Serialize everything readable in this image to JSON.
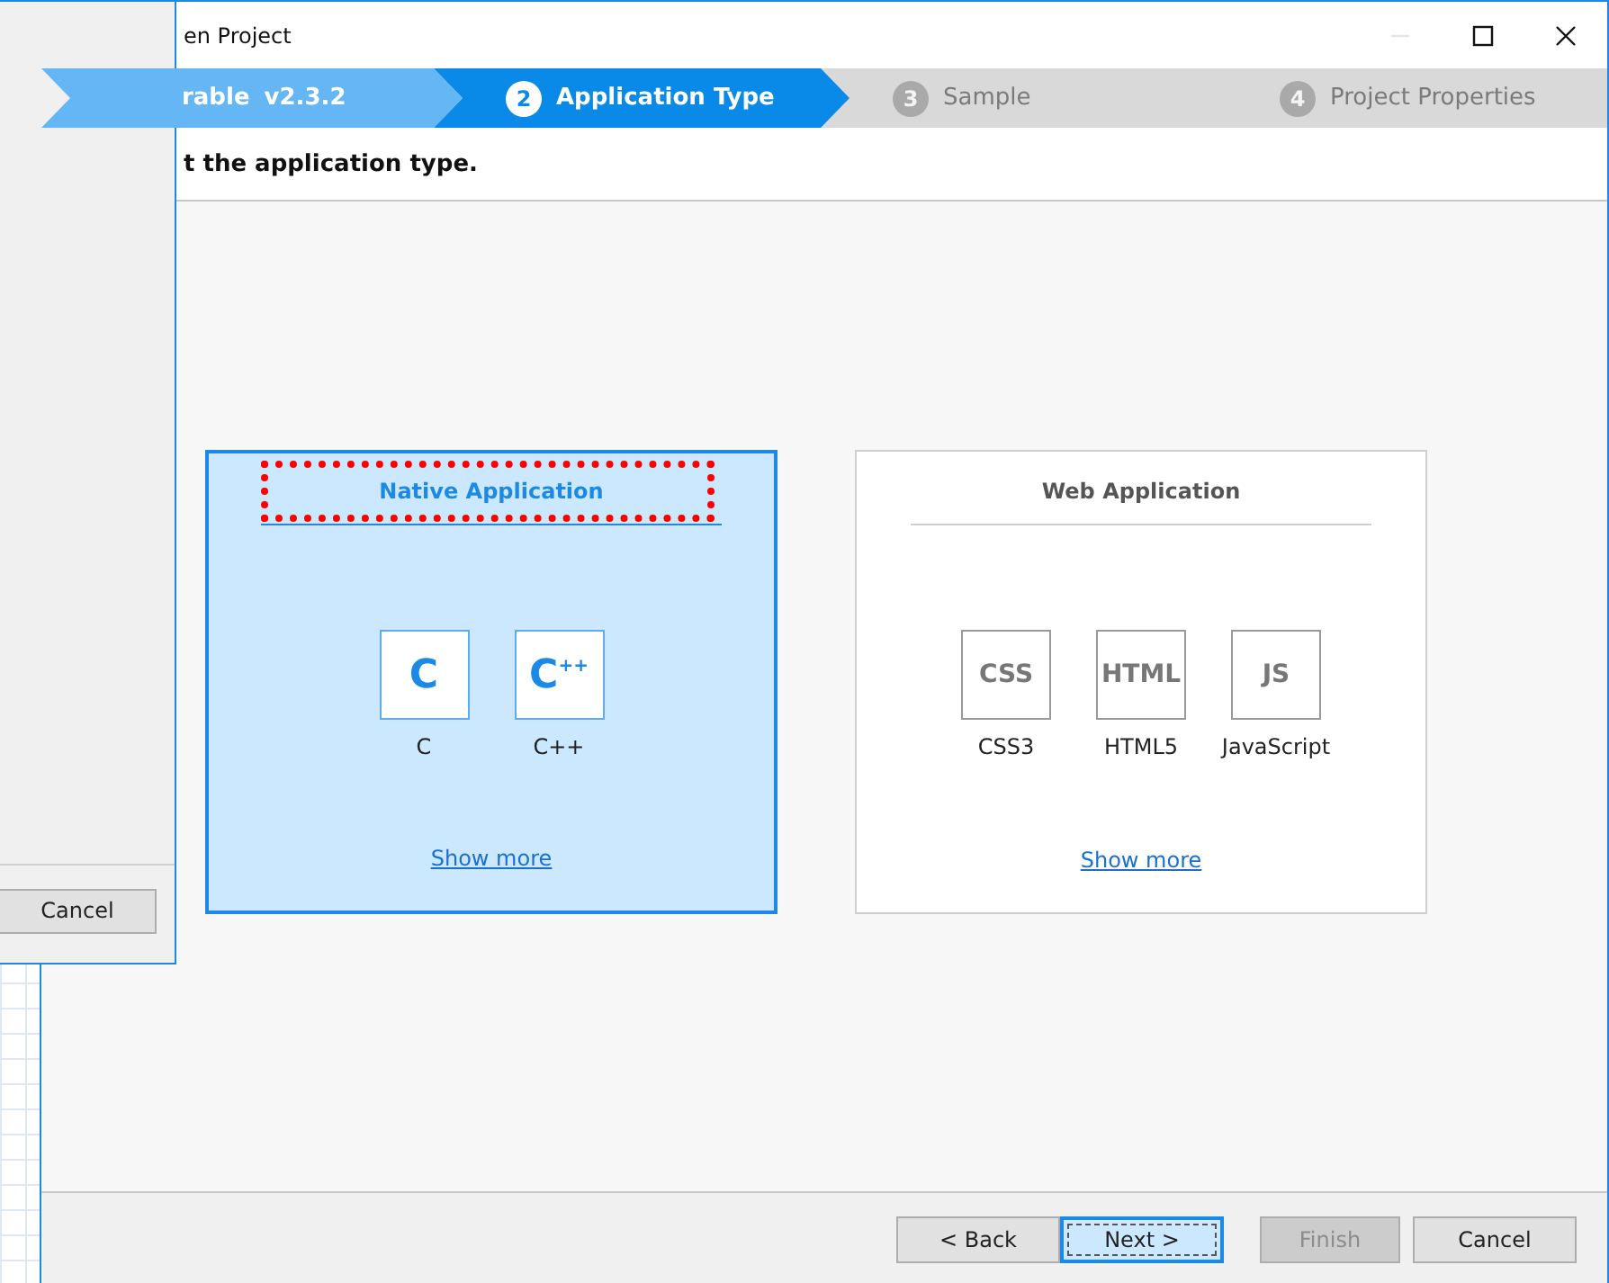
{
  "back_dialog": {
    "buttons": [
      {
        "label": "Cancel"
      }
    ]
  },
  "window": {
    "title": "en Project",
    "controls": [
      {
        "kind": "minimize",
        "disabled": true
      },
      {
        "kind": "maximize",
        "disabled": false
      },
      {
        "kind": "close",
        "disabled": false
      }
    ]
  },
  "steps": [
    {
      "label": "rable",
      "version": "v2.3.2",
      "selected": false,
      "done": true
    },
    {
      "number": "2",
      "label": "Application Type",
      "selected": true,
      "done": false
    },
    {
      "number": "3",
      "label": "Sample",
      "selected": false,
      "done": false
    },
    {
      "number": "4",
      "label": "Project Properties",
      "selected": false,
      "done": false
    }
  ],
  "instruction": "t the application type.",
  "cards": [
    {
      "title": "Native Application",
      "selected": true,
      "focused": true,
      "templates": [
        {
          "icon": "C",
          "label": "C"
        },
        {
          "icon": "C",
          "sup": "++",
          "label": "C++"
        }
      ],
      "link": "Show more"
    },
    {
      "title": "Web Application",
      "selected": false,
      "focused": false,
      "templates": [
        {
          "icon": "CSS",
          "label": "CSS3"
        },
        {
          "icon": "HTML",
          "label": "HTML5"
        },
        {
          "icon": "JS",
          "label": "JavaScript"
        }
      ],
      "link": "Show more"
    }
  ],
  "buttons": [
    {
      "label": "< Back",
      "disabled": false,
      "default": false
    },
    {
      "label": "Next >",
      "disabled": false,
      "default": true
    },
    {
      "label": "Finish",
      "disabled": true,
      "default": false
    },
    {
      "label": "Cancel",
      "disabled": false,
      "default": false
    }
  ]
}
